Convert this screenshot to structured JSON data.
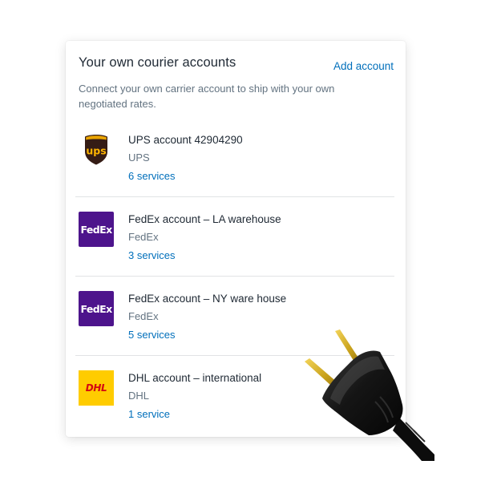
{
  "card": {
    "title": "Your own courier accounts",
    "add_link": "Add account",
    "description": "Connect your own carrier account to ship with your own negotiated rates."
  },
  "accounts": [
    {
      "name": "UPS account 42904290",
      "carrier": "UPS",
      "services": "6 services",
      "logo": "ups-shield",
      "logo_text": "ups"
    },
    {
      "name": "FedEx account – LA warehouse",
      "carrier": "FedEx",
      "services": "3 services",
      "logo": "fedex",
      "logo_text": "FedEx"
    },
    {
      "name": "FedEx account – NY ware house",
      "carrier": "FedEx",
      "services": "5 services",
      "logo": "fedex",
      "logo_text": "FedEx"
    },
    {
      "name": "DHL account – international",
      "carrier": "DHL",
      "services": "1 service",
      "logo": "dhl",
      "logo_text": "DHL"
    }
  ],
  "colors": {
    "link": "#006fbb",
    "title_text": "#212b36",
    "muted_text": "#637381",
    "fedex_purple": "#4d148c",
    "dhl_yellow": "#ffcc00",
    "dhl_red": "#d40511",
    "ups_brown": "#351c15",
    "ups_gold": "#ffb500"
  }
}
